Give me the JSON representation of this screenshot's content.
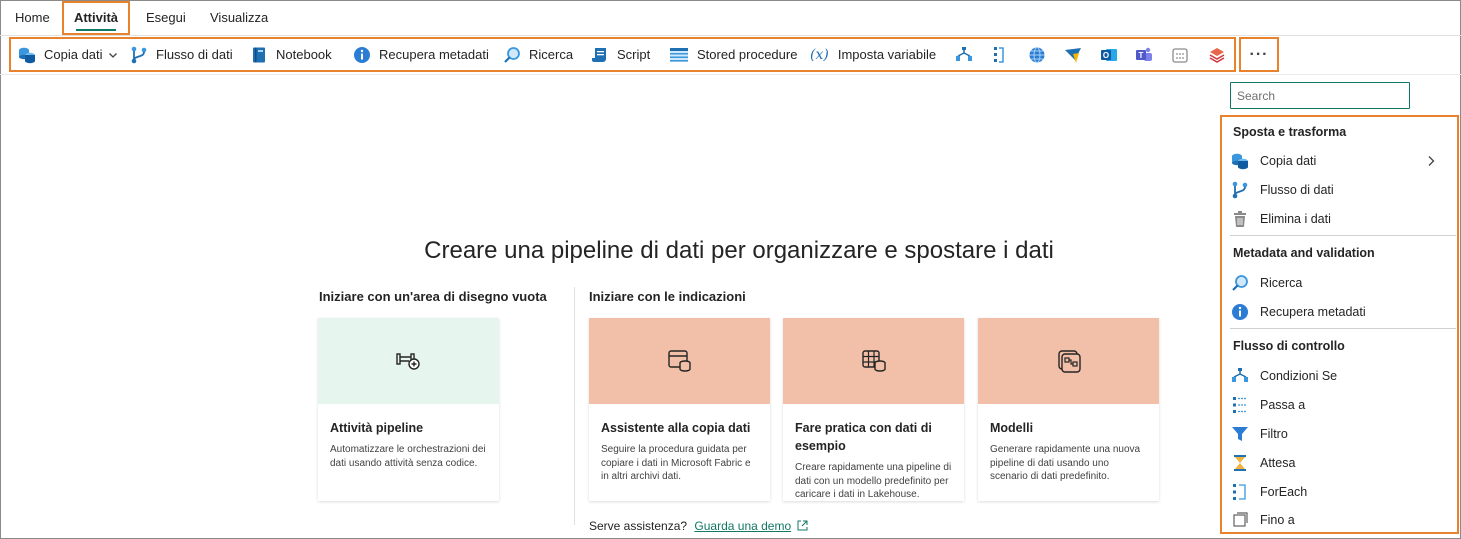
{
  "tabs": {
    "home": "Home",
    "attivita": "Attività",
    "esegui": "Esegui",
    "visualizza": "Visualizza"
  },
  "toolbar": {
    "copia_dati": "Copia dati",
    "flusso_di_dati": "Flusso di dati",
    "notebook": "Notebook",
    "recupera_metadati": "Recupera metadati",
    "ricerca": "Ricerca",
    "script": "Script",
    "stored_procedure": "Stored procedure",
    "imposta_variabile": "Imposta variabile",
    "icon_only_items": [
      "if-condition-icon",
      "switch-icon",
      "web-icon",
      "azure-function-icon",
      "outlook-icon",
      "teams-icon",
      "calendar-icon",
      "layers-icon"
    ],
    "more": "···"
  },
  "canvas": {
    "heading": "Creare una pipeline di dati per organizzare e spostare i dati",
    "blank_label": "Iniziare con un'area di disegno vuota",
    "guided_label": "Iniziare con le indicazioni",
    "cards": [
      {
        "title": "Attività pipeline",
        "desc": "Automatizzare le orchestrazioni dei dati usando attività senza codice.",
        "color": "#e6f6ef"
      },
      {
        "title": "Assistente alla copia dati",
        "desc": "Seguire la procedura guidata per copiare i dati in Microsoft Fabric e in altri archivi dati.",
        "color": "#f2c0a8"
      },
      {
        "title": "Fare pratica con dati di esempio",
        "desc": "Creare rapidamente una pipeline di dati con un modello predefinito per caricare i dati in Lakehouse.",
        "color": "#f2c0a8"
      },
      {
        "title": "Modelli",
        "desc": "Generare rapidamente una nuova pipeline di dati usando uno scenario di dati predefinito.",
        "color": "#f2c0a8"
      }
    ],
    "help_text": "Serve assistenza?",
    "help_link": "Guarda una demo"
  },
  "panel": {
    "search_placeholder": "Search",
    "sections": [
      {
        "title": "Sposta e trasforma",
        "items": [
          "Copia dati",
          "Flusso di dati",
          "Elimina i dati"
        ]
      },
      {
        "title": "Metadata and validation",
        "items": [
          "Ricerca",
          "Recupera metadati"
        ]
      },
      {
        "title": "Flusso di controllo",
        "items": [
          "Condizioni Se",
          "Passa a",
          "Filtro",
          "Attesa",
          "ForEach",
          "Fino a"
        ]
      }
    ]
  },
  "colors": {
    "highlight": "#e8822d",
    "accent": "#117865",
    "card_green": "#e6f6ef",
    "card_salmon": "#f2c0a8"
  }
}
